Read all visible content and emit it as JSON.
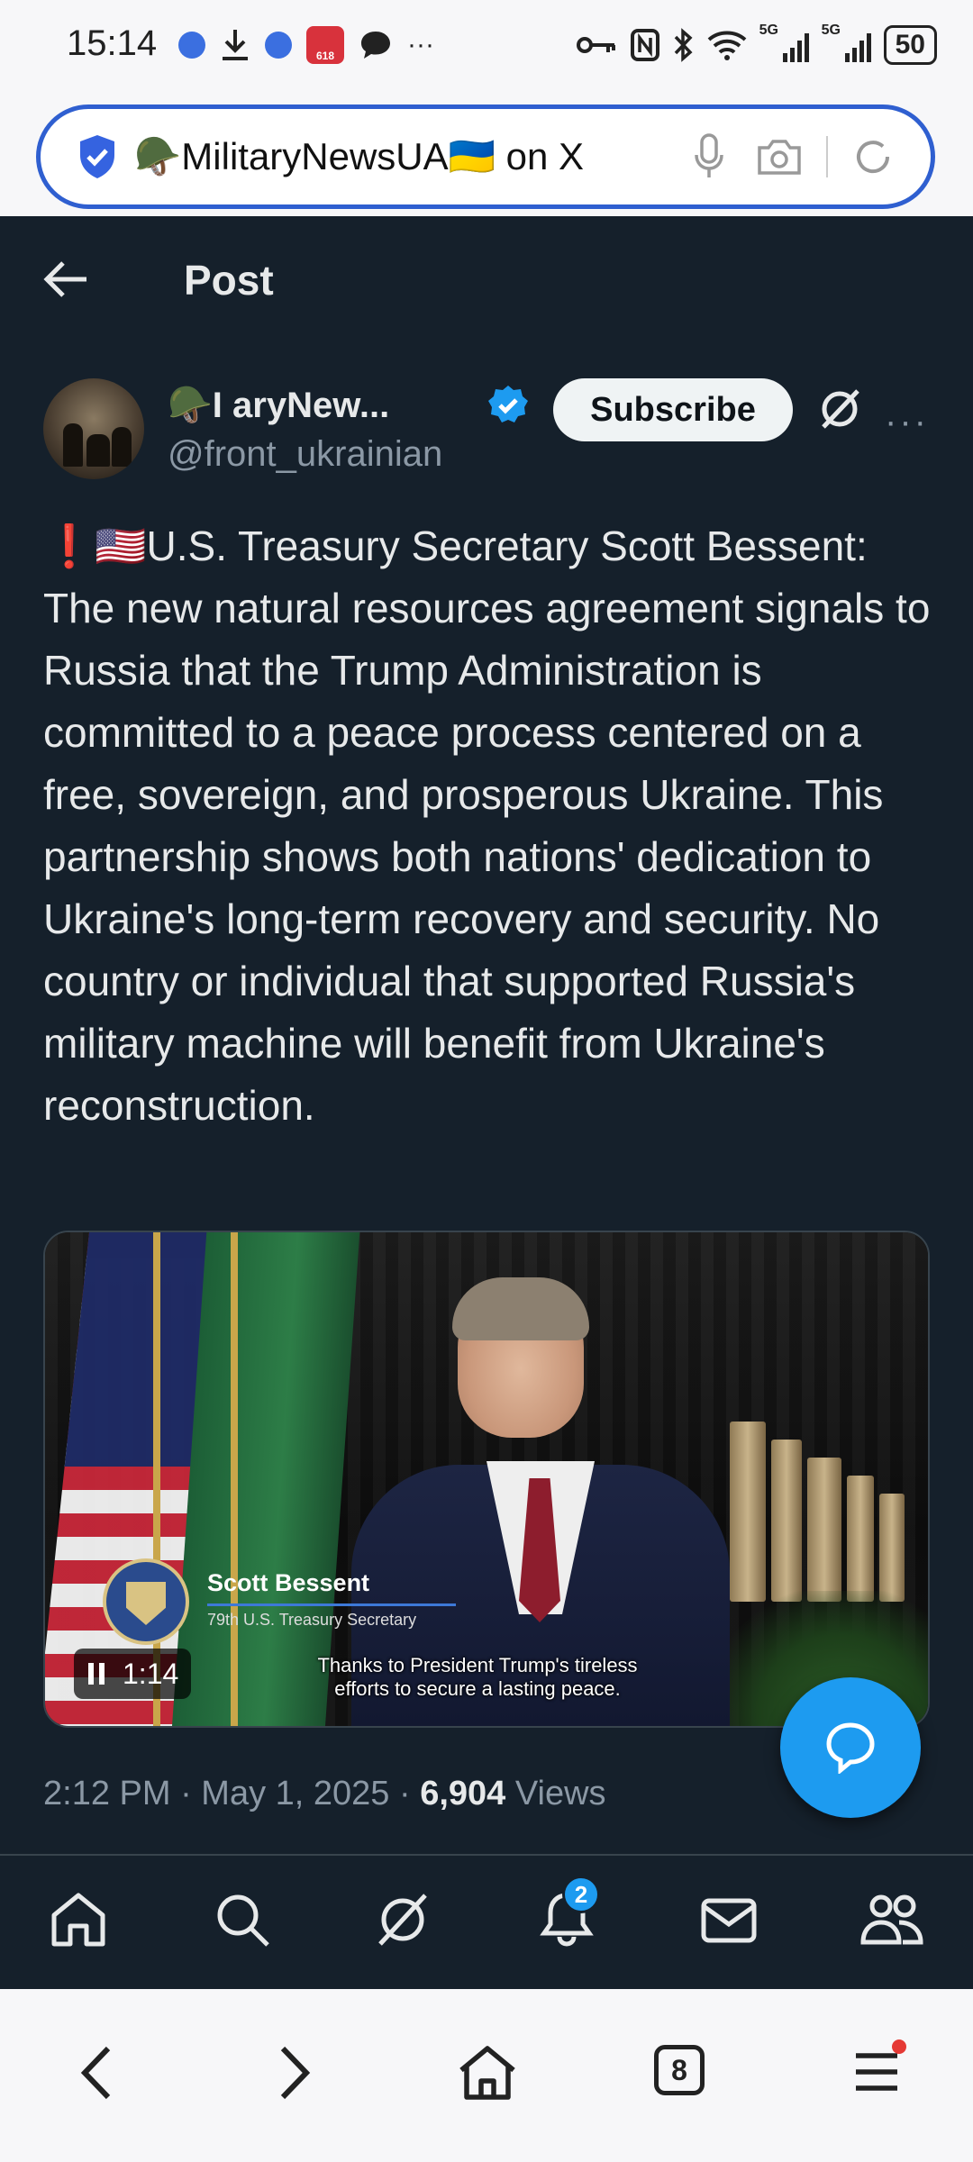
{
  "status_bar": {
    "time": "15:14",
    "network_left": "5G",
    "network_right": "5G",
    "battery": "50",
    "badge_618": "618"
  },
  "browser": {
    "url_title": "🪖MilitaryNewsUA🇺🇦 on X",
    "tabs_count": "8"
  },
  "header": {
    "title": "Post"
  },
  "author": {
    "display_name": "🪖I   aryNew...",
    "handle": "@front_ukrainian",
    "subscribe_label": "Subscribe"
  },
  "tweet": {
    "text": "❗🇺🇸U.S. Treasury Secretary Scott Bessent: The new natural resources agreement signals to Russia that the Trump Administration is committed to a peace process centered on a free, sovereign, and prosperous Ukraine. This partnership shows both nations' dedication to Ukraine's long-term recovery and security. No country or individual that supported Russia's military machine will benefit from Ukraine's reconstruction.",
    "time": "2:12 PM · May 1, 2025 · ",
    "views_count": "6,904",
    "views_label": " Views"
  },
  "video": {
    "lower_third_name": "Scott Bessent",
    "lower_third_title": "79th U.S. Treasury Secretary",
    "timecode": "1:14",
    "caption_line1": "Thanks to President Trump's tireless",
    "caption_line2": "efforts to secure a lasting peace."
  },
  "bottom_nav": {
    "notifications_badge": "2"
  },
  "colors": {
    "background": "#15202b",
    "accent": "#1d9bf0",
    "text_primary": "#e7e9ea",
    "text_secondary": "#8b98a5"
  }
}
